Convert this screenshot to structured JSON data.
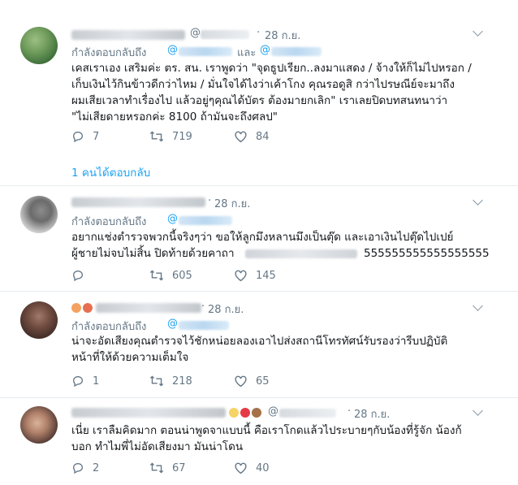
{
  "tweets": [
    {
      "date": "28 ก.ย.",
      "handle_prefix": "@",
      "reply_label": "กำลังตอบกลับถึง",
      "reply_at_1": "@",
      "reply_and": "และ",
      "reply_at_2": "@",
      "text": "เคสเราเอง เสริมค่ะ ตร. สน. เราพูดว่า \"จุดธูปเรียก..ลงมาแสดง / จ้างให้ก็ไม่ไปหรอก /\nเก็บเงินไว้กินข้าวดีกว่าไหม / มั่นใจได้ไงว่าเค้าโกง คุณรอดูสิ กว่าไปรษณีย์จะมาถึง\nผมเสียเวลาทำเรื่องไป แล้วอยู่ๆคุณได้บัตร ต้องมายกเลิก\" เราเลยปิดบทสนทนาว่า\n\"ไม่เสียดายหรอกค่ะ 8100 ถ้ามันจะถึงศลป\"",
      "replies": "7",
      "retweets": "719",
      "likes": "84",
      "thread_link": "1 คนได้ตอบกลับ"
    },
    {
      "date": "28 ก.ย.",
      "reply_label": "กำลังตอบกลับถึง",
      "reply_at_1": "@",
      "text": "อยากแช่งตำรวจพวกนี้จริงๆว่า ขอให้ลูกมึงหลานมึงเป็นตุ๊ด และเอาเงินไปตุ๊ดไปเปย์\nผู้ชายไม่จบไม่สิ้น ปิดท้ายด้วยคาถา",
      "text_tail": "555555555555555555",
      "replies": "",
      "retweets": "605",
      "likes": "145"
    },
    {
      "date": "28 ก.ย.",
      "reply_label": "กำลังตอบกลับถึง",
      "reply_at_1": "@",
      "text": "น่าจะอัดเสียงคุณตำรวจไว้ชักหน่อยลองเอาไปส่งสถานีโทรทัศน์รับรองว่ารีบปฏิบัติ\nหน้าที่ให้ด้วยความเต็มใจ",
      "replies": "1",
      "retweets": "218",
      "likes": "65"
    },
    {
      "date": "28 ก.ย.",
      "handle_prefix": "@",
      "text": "เนี่ย เราลืมคิดมาก ตอนน่าพูดจาแบบนี้ คือเราโกดแล้วไประบายๆกับน้องที่รู้จัก น้องก้\nบอก ทำไมพี่ไม่อัดเสียงมา มันน่าโดน",
      "replies": "2",
      "retweets": "67",
      "likes": "40"
    }
  ],
  "colors": {
    "text": "#14171a",
    "secondary": "#657786",
    "link": "#1da1f2",
    "separator": "#e6ecf0"
  },
  "icons": {
    "reply": "reply-icon",
    "retweet": "retweet-icon",
    "like": "heart-icon",
    "more": "chevron-down-icon"
  }
}
